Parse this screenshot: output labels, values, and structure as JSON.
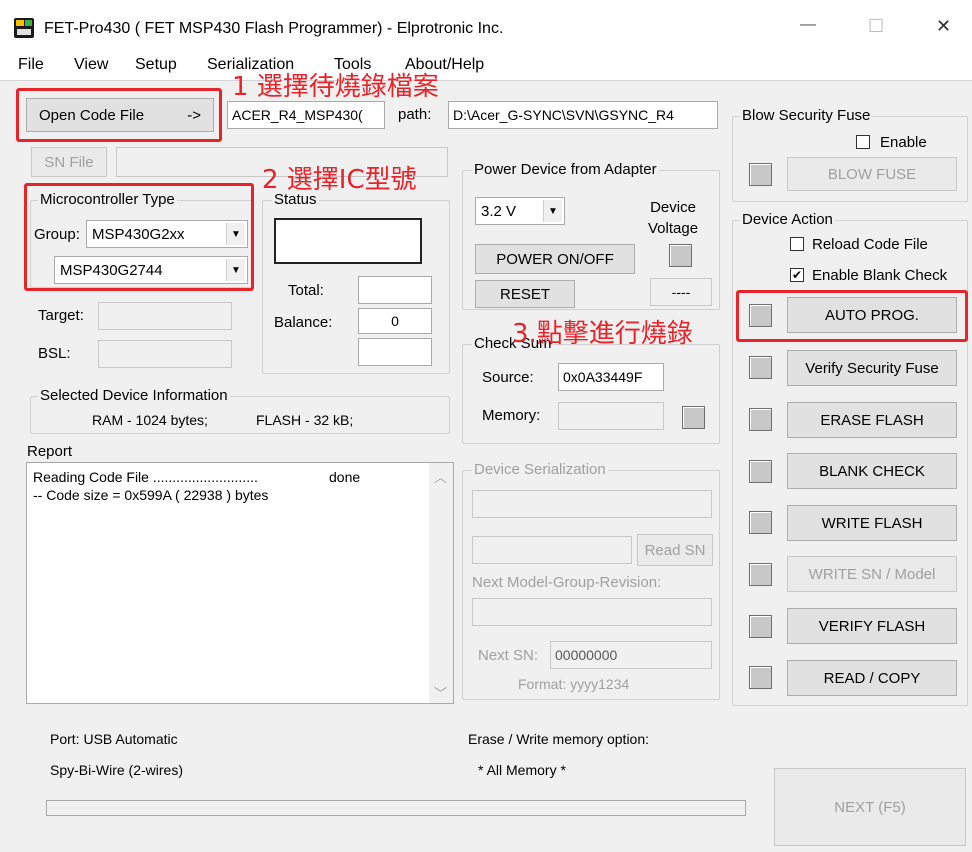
{
  "window": {
    "title": "FET-Pro430  ( FET MSP430 Flash Programmer)  -  Elprotronic Inc.",
    "controls": {
      "minimize": "—",
      "maximize": "☐",
      "close": "✕"
    }
  },
  "menu": [
    "File",
    "View",
    "Setup",
    "Serialization",
    "Tools",
    "About/Help"
  ],
  "annotations": {
    "step1": "1 選擇待燒錄檔案",
    "step2": "2 選擇IC型號",
    "step3": "3.點擊進行燒錄"
  },
  "code_file": {
    "button": "Open Code File",
    "arrow": "->",
    "filename": "ACER_R4_MSP430(",
    "path_label": "path:",
    "path": "D:\\Acer_G-SYNC\\SVN\\GSYNC_R4"
  },
  "sn_file": {
    "button": "SN File",
    "value": ""
  },
  "micro": {
    "title": "Microcontroller Type",
    "group_label": "Group:",
    "group_value": "MSP430G2xx",
    "device_value": "MSP430G2744",
    "arrow": "▼"
  },
  "status": {
    "title": "Status",
    "total_label": "Total:",
    "total_value": "",
    "balance_label": "Balance:",
    "balance_value": "0"
  },
  "target": {
    "label": "Target:",
    "value": ""
  },
  "bsl": {
    "label": "BSL:",
    "value": ""
  },
  "device_info": {
    "title": "Selected Device Information",
    "ram": "RAM  -  1024 bytes;",
    "flash": "FLASH - 32 kB;"
  },
  "report": {
    "title": "Report",
    "lines": [
      {
        "text": "Reading Code File ...........................",
        "status": "done"
      },
      {
        "text": "-- Code size = 0x599A ( 22938 ) bytes",
        "status": ""
      }
    ],
    "scroll_up": "︿",
    "scroll_down": "﹀"
  },
  "power": {
    "title": "Power Device from Adapter",
    "voltage": "3.2 V",
    "device_voltage_label": "Device\nVoltage",
    "power_button": "POWER ON/OFF",
    "reset_button": "RESET",
    "reading": "----"
  },
  "checksum": {
    "title": "Check Sum",
    "source_label": "Source:",
    "source_value": "0x0A33449F",
    "memory_label": "Memory:",
    "memory_value": ""
  },
  "serialization": {
    "title": "Device Serialization",
    "read_sn": "Read SN",
    "next_model_label": "Next Model-Group-Revision:",
    "next_sn_label": "Next SN:",
    "next_sn_value": "00000000",
    "format": "Format: yyyy1234"
  },
  "blow_fuse": {
    "title": "Blow Security Fuse",
    "enable_label": "Enable",
    "enabled": false,
    "button": "BLOW FUSE"
  },
  "device_action": {
    "title": "Device Action",
    "reload_label": "Reload Code File",
    "reload_checked": false,
    "blank_label": "Enable Blank Check",
    "blank_checked": true,
    "checkmark": "✔",
    "buttons": [
      "AUTO PROG.",
      "Verify Security Fuse",
      "ERASE FLASH",
      "BLANK CHECK",
      "WRITE FLASH",
      "WRITE SN / Model",
      "VERIFY FLASH",
      "READ / COPY"
    ]
  },
  "footer": {
    "port": "Port: USB Automatic",
    "interface": "Spy-Bi-Wire (2-wires)",
    "erase_label": "Erase / Write memory option:",
    "erase_value": "* All Memory *",
    "next_button": "NEXT  (F5)"
  }
}
